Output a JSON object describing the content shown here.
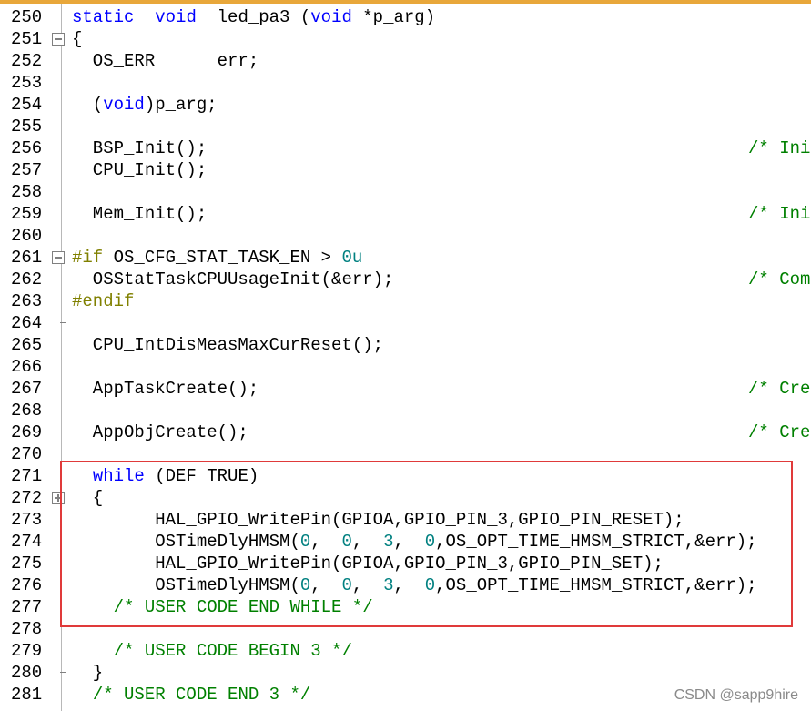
{
  "editor": {
    "lines": [
      {
        "n": "250",
        "parts": [
          {
            "t": "static",
            "c": "kw"
          },
          {
            "t": "  "
          },
          {
            "t": "void",
            "c": "kw"
          },
          {
            "t": "  led_pa3 ("
          },
          {
            "t": "void",
            "c": "kw"
          },
          {
            "t": " *p_arg)"
          }
        ]
      },
      {
        "n": "251",
        "fold": "minus",
        "parts": [
          {
            "t": "{"
          }
        ]
      },
      {
        "n": "252",
        "parts": [
          {
            "t": "  OS_ERR      err;"
          }
        ]
      },
      {
        "n": "253",
        "parts": []
      },
      {
        "n": "254",
        "parts": [
          {
            "t": "  ("
          },
          {
            "t": "void",
            "c": "kw"
          },
          {
            "t": ")p_arg;"
          }
        ]
      },
      {
        "n": "255",
        "parts": []
      },
      {
        "n": "256",
        "parts": [
          {
            "t": "  BSP_Init();"
          }
        ],
        "comment": "/* Ini"
      },
      {
        "n": "257",
        "parts": [
          {
            "t": "  CPU_Init();"
          }
        ]
      },
      {
        "n": "258",
        "parts": []
      },
      {
        "n": "259",
        "parts": [
          {
            "t": "  Mem_Init();"
          }
        ],
        "comment": "/* Ini"
      },
      {
        "n": "260",
        "parts": []
      },
      {
        "n": "261",
        "fold": "minus",
        "parts": [
          {
            "t": "#if",
            "c": "pp"
          },
          {
            "t": " OS_CFG_STAT_TASK_EN > "
          },
          {
            "t": "0u",
            "c": "nm"
          }
        ]
      },
      {
        "n": "262",
        "parts": [
          {
            "t": "  OSStatTaskCPUUsageInit(&err);"
          }
        ],
        "comment": "/* Com"
      },
      {
        "n": "263",
        "parts": [
          {
            "t": "#endif",
            "c": "pp"
          }
        ]
      },
      {
        "n": "264",
        "foldEnd": true,
        "parts": []
      },
      {
        "n": "265",
        "parts": [
          {
            "t": "  CPU_IntDisMeasMaxCurReset();"
          }
        ]
      },
      {
        "n": "266",
        "parts": []
      },
      {
        "n": "267",
        "parts": [
          {
            "t": "  AppTaskCreate();"
          }
        ],
        "comment": "/* Cre"
      },
      {
        "n": "268",
        "parts": []
      },
      {
        "n": "269",
        "parts": [
          {
            "t": "  AppObjCreate();"
          }
        ],
        "comment": "/* Cre"
      },
      {
        "n": "270",
        "parts": []
      },
      {
        "n": "271",
        "parts": [
          {
            "t": "  "
          },
          {
            "t": "while",
            "c": "kw"
          },
          {
            "t": " (DEF_TRUE)"
          }
        ]
      },
      {
        "n": "272",
        "fold": "plus",
        "parts": [
          {
            "t": "  {"
          }
        ]
      },
      {
        "n": "273",
        "parts": [
          {
            "t": "        HAL_GPIO_WritePin(GPIOA,GPIO_PIN_3,GPIO_PIN_RESET);"
          }
        ]
      },
      {
        "n": "274",
        "parts": [
          {
            "t": "        OSTimeDlyHMSM("
          },
          {
            "t": "0",
            "c": "nm"
          },
          {
            "t": ",  "
          },
          {
            "t": "0",
            "c": "nm"
          },
          {
            "t": ",  "
          },
          {
            "t": "3",
            "c": "nm"
          },
          {
            "t": ",  "
          },
          {
            "t": "0",
            "c": "nm"
          },
          {
            "t": ",OS_OPT_TIME_HMSM_STRICT,&err);"
          }
        ]
      },
      {
        "n": "275",
        "parts": [
          {
            "t": "        HAL_GPIO_WritePin(GPIOA,GPIO_PIN_3,GPIO_PIN_SET);"
          }
        ]
      },
      {
        "n": "276",
        "parts": [
          {
            "t": "        OSTimeDlyHMSM("
          },
          {
            "t": "0",
            "c": "nm"
          },
          {
            "t": ",  "
          },
          {
            "t": "0",
            "c": "nm"
          },
          {
            "t": ",  "
          },
          {
            "t": "3",
            "c": "nm"
          },
          {
            "t": ",  "
          },
          {
            "t": "0",
            "c": "nm"
          },
          {
            "t": ",OS_OPT_TIME_HMSM_STRICT,&err);"
          }
        ]
      },
      {
        "n": "277",
        "parts": [
          {
            "t": "    "
          },
          {
            "t": "/* USER CODE END WHILE */",
            "c": "cm"
          }
        ]
      },
      {
        "n": "278",
        "parts": []
      },
      {
        "n": "279",
        "parts": [
          {
            "t": "    "
          },
          {
            "t": "/* USER CODE BEGIN 3 */",
            "c": "cm"
          }
        ]
      },
      {
        "n": "280",
        "foldEnd": true,
        "parts": [
          {
            "t": "  }"
          }
        ]
      },
      {
        "n": "281",
        "parts": [
          {
            "t": "  "
          },
          {
            "t": "/* USER CODE END 3 */",
            "c": "cm"
          }
        ]
      }
    ]
  },
  "watermark": "CSDN @sapp9hire",
  "colors": {
    "keyword": "#0000ff",
    "comment": "#008000",
    "preprocessor": "#808000",
    "number": "#008080",
    "highlight_border": "#e03a3a"
  }
}
